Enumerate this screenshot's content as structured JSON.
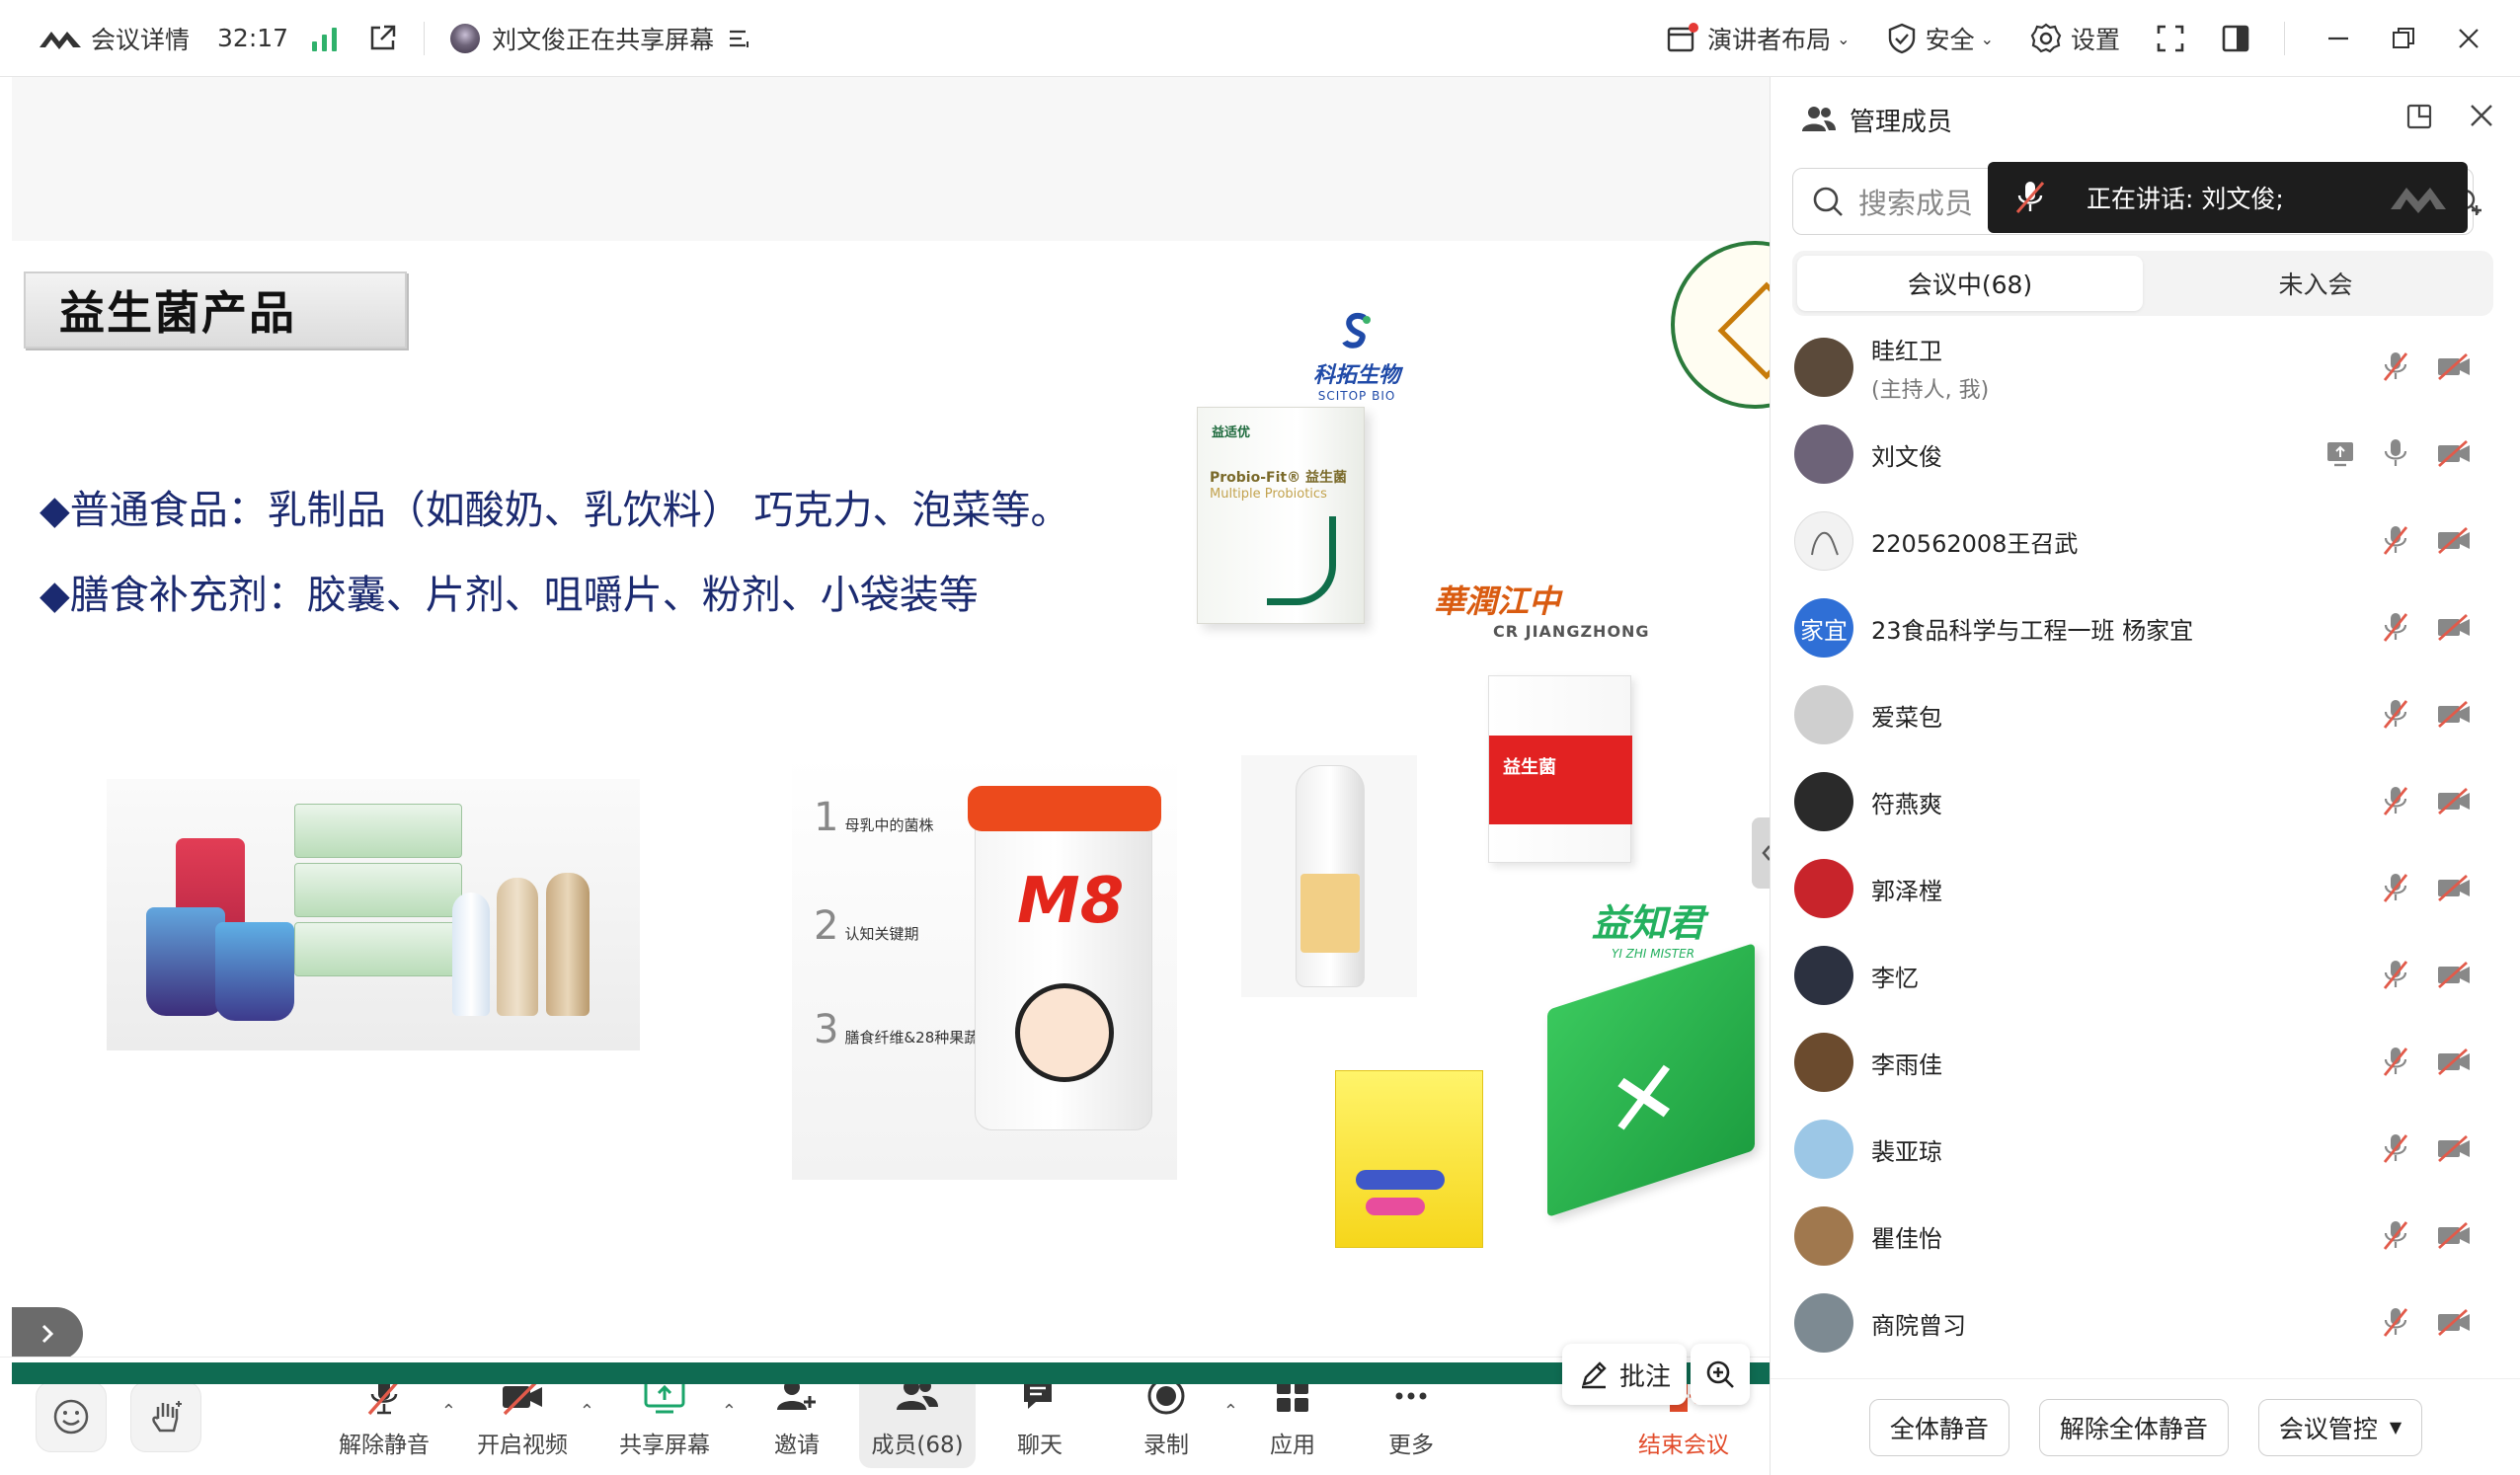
{
  "topbar": {
    "meeting_details": "会议详情",
    "timer": "32:17",
    "sharing_status": "刘文俊正在共享屏幕",
    "speaker_layout": "演讲者布局",
    "security": "安全",
    "settings": "设置"
  },
  "slide": {
    "title": "益生菌产品",
    "bullet1": "◆普通食品：乳制品（如酸奶、乳饮料） 巧克力、泡菜等。",
    "bullet2": "◆膳食补充剂：胶囊、片剂、咀嚼片、粉剂、小袋装等",
    "brand_scitop_cn": "科拓生物",
    "brand_scitop_en": "SCITOP BIO",
    "brand_jiangzhong_cn": "華潤江中",
    "brand_jiangzhong_en": "CR JIANGZHONG",
    "brand_yzj_cn": "益知君",
    "brand_yzj_en": "YI ZHI MISTER",
    "probiofit_tag": "益适优",
    "probiofit_name": "Probio-Fit® 益生菌",
    "probiofit_name2": "Multiple Probiotics",
    "m8_text": "M8",
    "m8_step1": "母乳中的菌株",
    "m8_step2": "认知关键期",
    "m8_step3": "膳食纤维&28种果蔬",
    "redbox_text": "益生菌",
    "annotate_label": "批注"
  },
  "panel": {
    "title": "管理成员",
    "search_placeholder": "搜索成员",
    "speaking_label": "正在讲话:  刘文俊;",
    "tab_in_meeting": "会议中(68)",
    "tab_not_joined": "未入会",
    "members": [
      {
        "name": "眭红卫",
        "sub": "(主持人, 我)",
        "avatar_color": "#5b4a3a"
      },
      {
        "name": "刘文俊",
        "sub": "",
        "avatar_color": "#6d6378"
      },
      {
        "name": "220562008王召武",
        "sub": "",
        "avatar_color": "#f2f2f2"
      },
      {
        "name": "23食品科学与工程一班 杨家宜",
        "sub": "",
        "avatar_color": "#2f6fd6",
        "avatar_text": "家宜"
      },
      {
        "name": "爱菜包",
        "sub": "",
        "avatar_color": "#cfcfcf"
      },
      {
        "name": "符燕爽",
        "sub": "",
        "avatar_color": "#2a2a2a"
      },
      {
        "name": "郭泽樘",
        "sub": "",
        "avatar_color": "#c8242b"
      },
      {
        "name": "李忆",
        "sub": "",
        "avatar_color": "#2c3140"
      },
      {
        "name": "李雨佳",
        "sub": "",
        "avatar_color": "#6b4b2e"
      },
      {
        "name": "裴亚琼",
        "sub": "",
        "avatar_color": "#9cc7e6"
      },
      {
        "name": "瞿佳怡",
        "sub": "",
        "avatar_color": "#a0784e"
      },
      {
        "name": "商院曾习",
        "sub": "",
        "avatar_color": "#7d8a92"
      }
    ],
    "mute_all": "全体静音",
    "unmute_all": "解除全体静音",
    "meeting_control": "会议管控"
  },
  "toolbar": {
    "unmute": "解除静音",
    "start_video": "开启视频",
    "share_screen": "共享屏幕",
    "invite": "邀请",
    "members": "成员(68)",
    "chat": "聊天",
    "record": "录制",
    "apps": "应用",
    "more": "更多",
    "end_meeting": "结束会议"
  },
  "colors": {
    "accent_green": "#0f6b52",
    "slide_text_blue": "#1b2a70",
    "end_red": "#e24b2a",
    "muted_red": "#e25a4a"
  }
}
